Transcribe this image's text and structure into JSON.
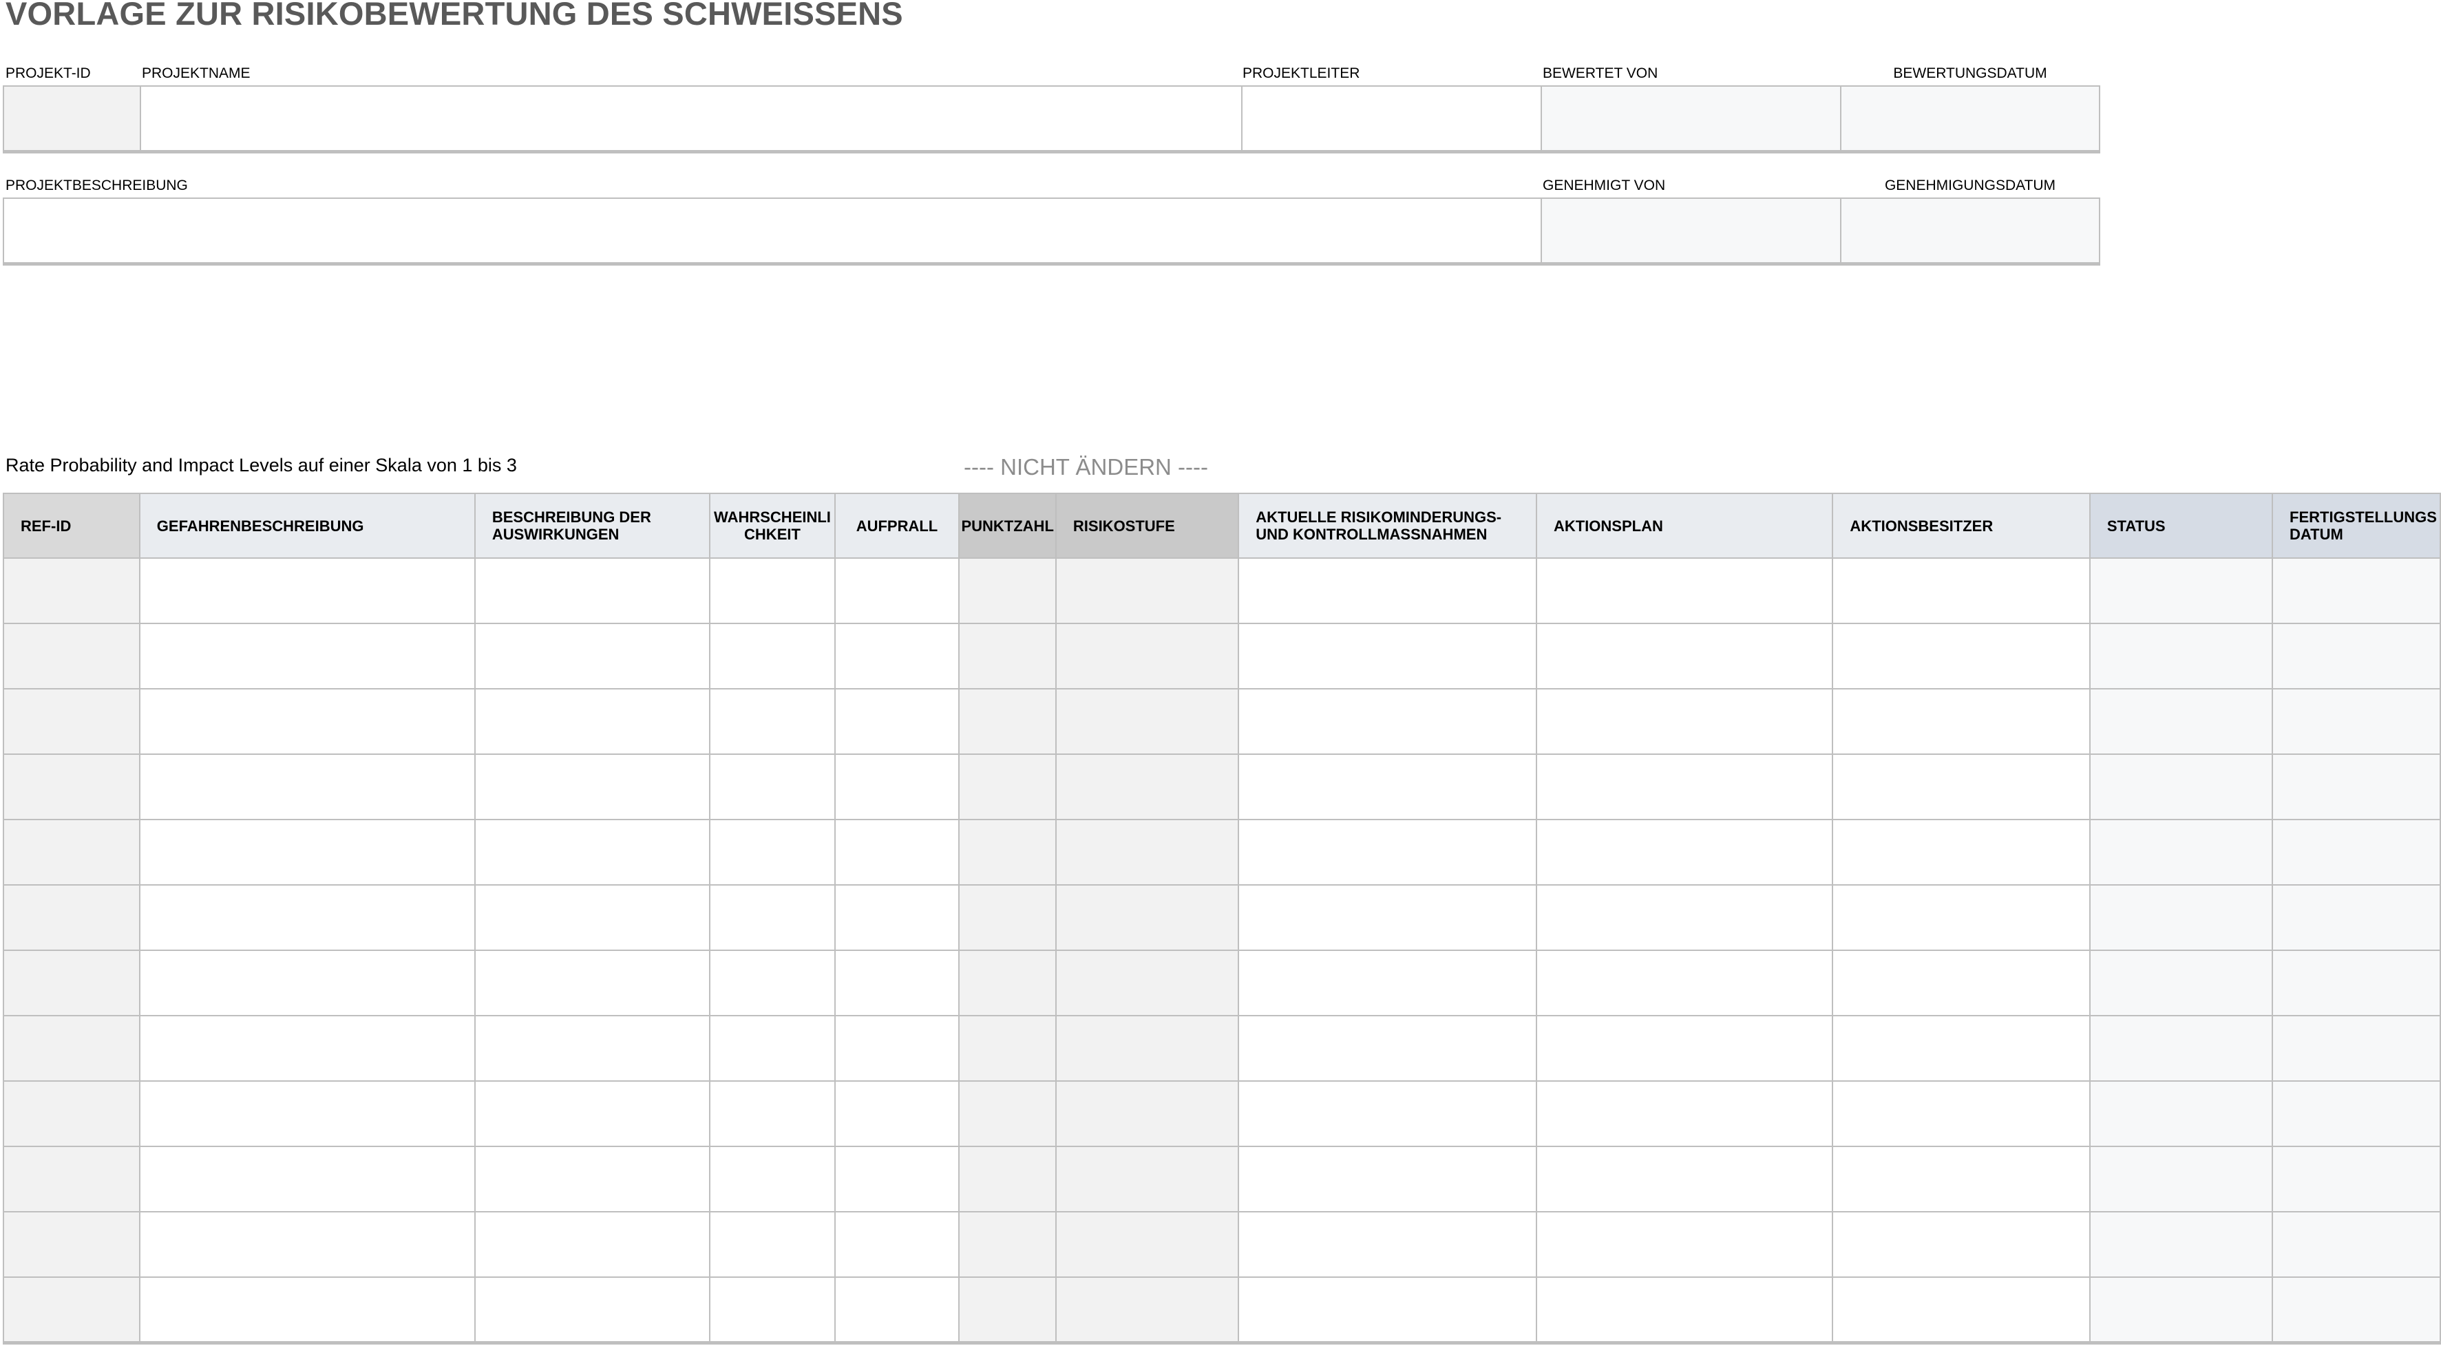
{
  "title": "VORLAGE ZUR RISIKOBEWERTUNG DES SCHWEISSENS",
  "project": {
    "id_label": "PROJEKT-ID",
    "name_label": "PROJEKTNAME",
    "lead_label": "PROJEKTLEITER",
    "rated_by_label": "BEWERTET VON",
    "rating_date_label": "BEWERTUNGSDATUM",
    "description_label": "PROJEKTBESCHREIBUNG",
    "approved_by_label": "GENEHMIGT VON",
    "approval_date_label": "GENEHMIGUNGSDATUM",
    "id_value": "",
    "name_value": "",
    "lead_value": "",
    "rated_by_value": "",
    "rating_date_value": "",
    "description_value": "",
    "approved_by_value": "",
    "approval_date_value": ""
  },
  "instructions": "Rate Probability and Impact Levels auf einer Skala von 1 bis 3",
  "do_not_change": "---- NICHT ÄNDERN ----",
  "table": {
    "headers": [
      "REF-ID",
      "GEFAHRENBESCHREIBUNG",
      "BESCHREIBUNG DER AUSWIRKUNGEN",
      "WAHRSCHEINLICHKEIT",
      "AUFPRALL",
      "PUNKTZAHL",
      "RISIKOSTUFE",
      "AKTUELLE RISIKOMINDERUNGS- UND KONTROLLMASSNAHMEN",
      "AKTIONSPLAN",
      "AKTIONSBESITZER",
      "STATUS",
      "FERTIGSTELLUNGS DATUM"
    ],
    "rows": [
      [
        "",
        "",
        "",
        "",
        "",
        "",
        "",
        "",
        "",
        "",
        "",
        ""
      ],
      [
        "",
        "",
        "",
        "",
        "",
        "",
        "",
        "",
        "",
        "",
        "",
        ""
      ],
      [
        "",
        "",
        "",
        "",
        "",
        "",
        "",
        "",
        "",
        "",
        "",
        ""
      ],
      [
        "",
        "",
        "",
        "",
        "",
        "",
        "",
        "",
        "",
        "",
        "",
        ""
      ],
      [
        "",
        "",
        "",
        "",
        "",
        "",
        "",
        "",
        "",
        "",
        "",
        ""
      ],
      [
        "",
        "",
        "",
        "",
        "",
        "",
        "",
        "",
        "",
        "",
        "",
        ""
      ],
      [
        "",
        "",
        "",
        "",
        "",
        "",
        "",
        "",
        "",
        "",
        "",
        ""
      ],
      [
        "",
        "",
        "",
        "",
        "",
        "",
        "",
        "",
        "",
        "",
        "",
        ""
      ],
      [
        "",
        "",
        "",
        "",
        "",
        "",
        "",
        "",
        "",
        "",
        "",
        ""
      ],
      [
        "",
        "",
        "",
        "",
        "",
        "",
        "",
        "",
        "",
        "",
        "",
        ""
      ],
      [
        "",
        "",
        "",
        "",
        "",
        "",
        "",
        "",
        "",
        "",
        "",
        ""
      ],
      [
        "",
        "",
        "",
        "",
        "",
        "",
        "",
        "",
        "",
        "",
        "",
        ""
      ]
    ]
  },
  "colors": {
    "title": "#595959",
    "border": "#bfbfbf",
    "header_grey": "#d9d9d9",
    "header_blue": "#e9ecf0",
    "header_dark_grey": "#c9c9c9",
    "header_slate": "#d6dce5",
    "cell_grey": "#f2f2f2",
    "cell_light": "#f7f8f9",
    "do_not_change": "#8c8c8c"
  }
}
